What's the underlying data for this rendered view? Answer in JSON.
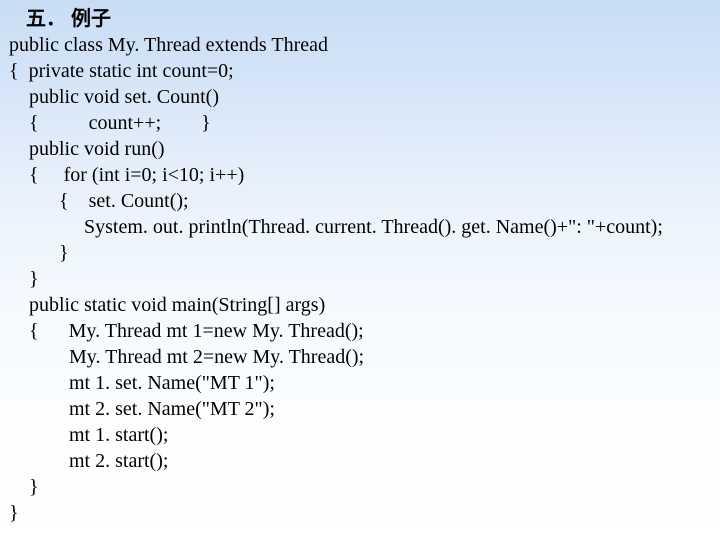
{
  "slide": {
    "heading": "五．  例子",
    "lines": [
      " public class My. Thread extends Thread",
      " {  private static int count=0;",
      "     public void set. Count()",
      "     {          count++;        }",
      "     public void run()",
      "     {     for (int i=0; i<10; i++)",
      "           {    set. Count();",
      "                System. out. println(Thread. current. Thread(). get. Name()+\": \"+count);",
      "           }",
      "     }",
      "     public static void main(String[] args)",
      "     {      My. Thread mt 1=new My. Thread();",
      "             My. Thread mt 2=new My. Thread();",
      "             mt 1. set. Name(\"MT 1\");",
      "             mt 2. set. Name(\"MT 2\");",
      "             mt 1. start();",
      "             mt 2. start();",
      "     }",
      " }"
    ]
  }
}
